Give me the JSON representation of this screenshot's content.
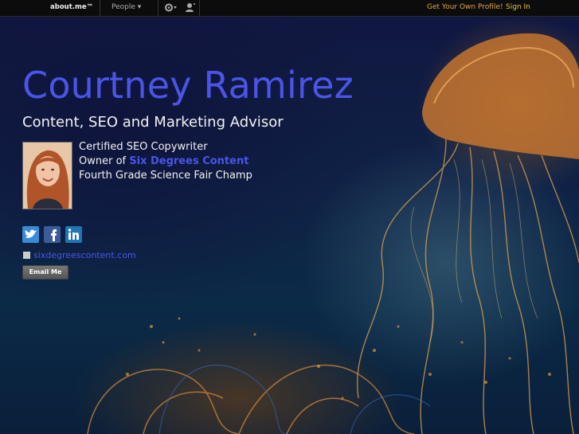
{
  "topbar": {
    "logo": "about.me™",
    "people_menu": "People ▾",
    "get_own_profile": "Get Your Own Profile!",
    "sign_in": "Sign In"
  },
  "profile": {
    "name": "Courtney Ramirez",
    "headline": "Content, SEO and Marketing Advisor",
    "bio": {
      "line1": "Certified SEO Copywriter",
      "line2_prefix": "Owner of ",
      "line2_link": "Six Degrees Content",
      "line3": "Fourth Grade Science Fair Champ"
    },
    "website": "sixdegreescontent.com",
    "email_button": "Email Me"
  },
  "social": [
    {
      "name": "twitter",
      "icon": "twitter-icon",
      "color": "#3a8ad6"
    },
    {
      "name": "facebook",
      "icon": "facebook-icon",
      "color": "#3b5b9a"
    },
    {
      "name": "linkedin",
      "icon": "linkedin-icon",
      "color": "#1f76b6"
    }
  ],
  "colors": {
    "name": "#4a55e8",
    "accent": "#e3a43a",
    "background": "#0b1a33"
  }
}
